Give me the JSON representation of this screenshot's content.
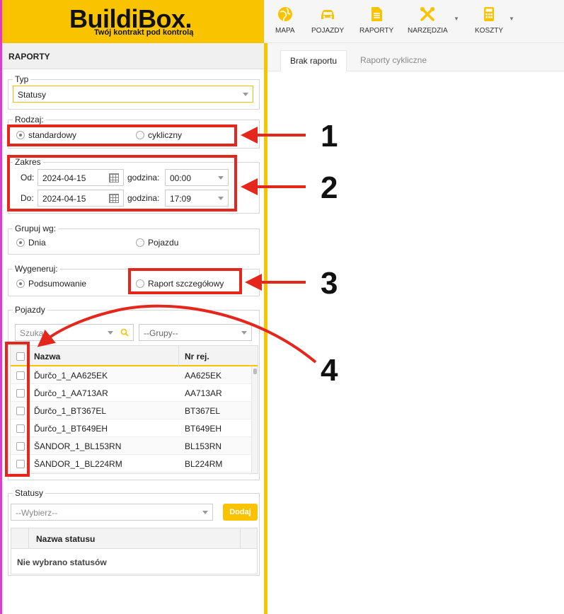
{
  "brand": {
    "title": "BuildiBox.",
    "subtitle": "Twój kontrakt pod kontrolą"
  },
  "nav": [
    {
      "label": "MAPA",
      "icon": "globe-icon"
    },
    {
      "label": "POJAZDY",
      "icon": "car-icon"
    },
    {
      "label": "RAPORTY",
      "icon": "document-icon"
    },
    {
      "label": "NARZĘDZIA",
      "icon": "tools-icon"
    },
    {
      "label": "KOSZTY",
      "icon": "calculator-icon"
    }
  ],
  "panel": {
    "title": "RAPORTY",
    "typ": {
      "legend": "Typ",
      "value": "Statusy"
    },
    "rodzaj": {
      "legend": "Rodzaj:",
      "opt1": "standardowy",
      "opt2": "cykliczny"
    },
    "zakres": {
      "legend": "Zakres",
      "od_label": "Od:",
      "od_date": "2024-04-15",
      "od_hour_label": "godzina:",
      "od_hour": "00:00",
      "do_label": "Do:",
      "do_date": "2024-04-15",
      "do_hour_label": "godzina:",
      "do_hour": "17:09"
    },
    "grupuj": {
      "legend": "Grupuj wg:",
      "opt1": "Dnia",
      "opt2": "Pojazdu"
    },
    "wygeneruj": {
      "legend": "Wygeneruj:",
      "opt1": "Podsumowanie",
      "opt2": "Raport szczegółowy"
    },
    "pojazdy": {
      "legend": "Pojazdy",
      "search_placeholder": "Szukaj",
      "groups_placeholder": "--Grupy--",
      "col_name": "Nazwa",
      "col_reg": "Nr rej.",
      "rows": [
        {
          "name": "Ďurčo_1_AA625EK",
          "reg": "AA625EK"
        },
        {
          "name": "Ďurčo_1_AA713AR",
          "reg": "AA713AR"
        },
        {
          "name": "Ďurčo_1_BT367EL",
          "reg": "BT367EL"
        },
        {
          "name": "Ďurčo_1_BT649EH",
          "reg": "BT649EH"
        },
        {
          "name": "ŠANDOR_1_BL153RN",
          "reg": "BL153RN"
        },
        {
          "name": "ŠANDOR_1_BL224RM",
          "reg": "BL224RM"
        }
      ]
    },
    "statusy": {
      "legend": "Statusy",
      "select_placeholder": "--Wybierz--",
      "add_button": "Dodaj",
      "col_name": "Nazwa statusu",
      "empty": "Nie wybrano statusów"
    }
  },
  "tabs": [
    {
      "label": "Brak raportu"
    },
    {
      "label": "Raporty cykliczne"
    }
  ],
  "callouts": [
    "1",
    "2",
    "3",
    "4"
  ],
  "colors": {
    "accent": "#f9c300",
    "annotation": "#e5261d"
  }
}
